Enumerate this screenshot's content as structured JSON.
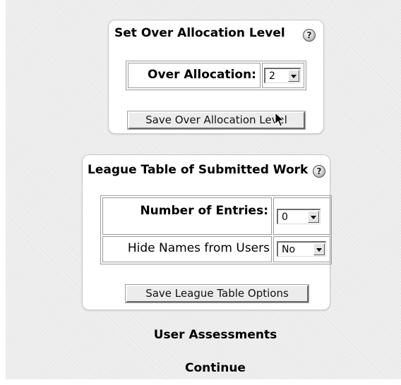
{
  "over_allocation_panel": {
    "title": "Set Over Allocation Level",
    "help_icon": "question-mark-icon",
    "field_label": "Over Allocation:",
    "field_value": "2",
    "save_button_label": "Save Over Allocation Level"
  },
  "league_table_panel": {
    "title": "League Table of Submitted Work",
    "help_icon": "question-mark-icon",
    "rows": [
      {
        "label": "Number of Entries:",
        "value": "0"
      },
      {
        "label": "Hide Names from Users",
        "value": "No"
      }
    ],
    "save_button_label": "Save League Table Options"
  },
  "links": {
    "user_assessments": "User Assessments",
    "continue": "Continue"
  },
  "cursor_icon": "mouse-pointer-icon"
}
